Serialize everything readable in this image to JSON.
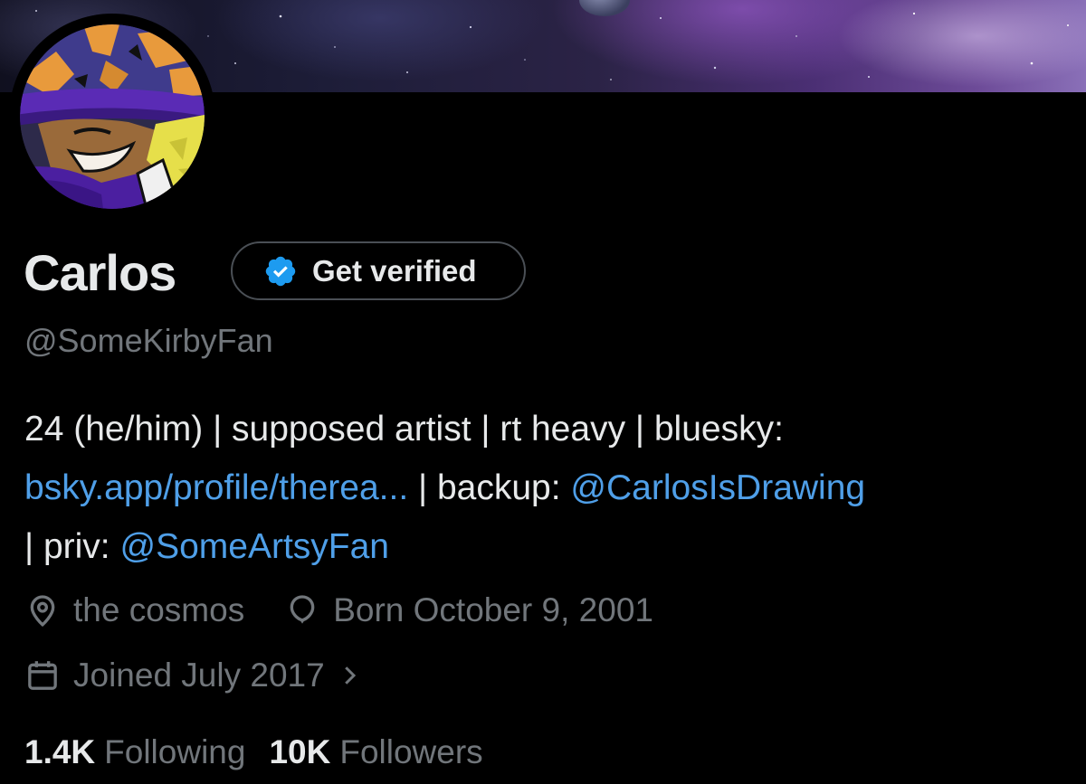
{
  "profile": {
    "display_name": "Carlos",
    "get_verified_label": "Get verified",
    "handle": "@SomeKirbyFan"
  },
  "bio": {
    "line1": "24 (he/him) | supposed artist | rt heavy | bluesky:",
    "link_bsky": "bsky.app/profile/therea...",
    "sep_backup": " | backup: ",
    "link_backup": "@CarlosIsDrawing",
    "sep_priv": "| priv: ",
    "link_priv": "@SomeArtsyFan"
  },
  "meta": {
    "location": "the cosmos",
    "birthday": "Born October 9, 2001",
    "joined": "Joined July 2017"
  },
  "stats": {
    "following_count": "1.4K",
    "following_label": "Following",
    "followers_count": "10K",
    "followers_label": "Followers"
  },
  "icons": {
    "verified_badge": "verified-badge-icon",
    "location": "location-pin-icon",
    "birthday": "balloon-icon",
    "joined": "calendar-icon",
    "chevron": "chevron-right-icon"
  },
  "colors": {
    "background": "#000000",
    "primary_text": "#e7e9ea",
    "secondary_text": "#71767b",
    "link": "#4f9fe8",
    "verified_blue": "#1d9bf0"
  }
}
